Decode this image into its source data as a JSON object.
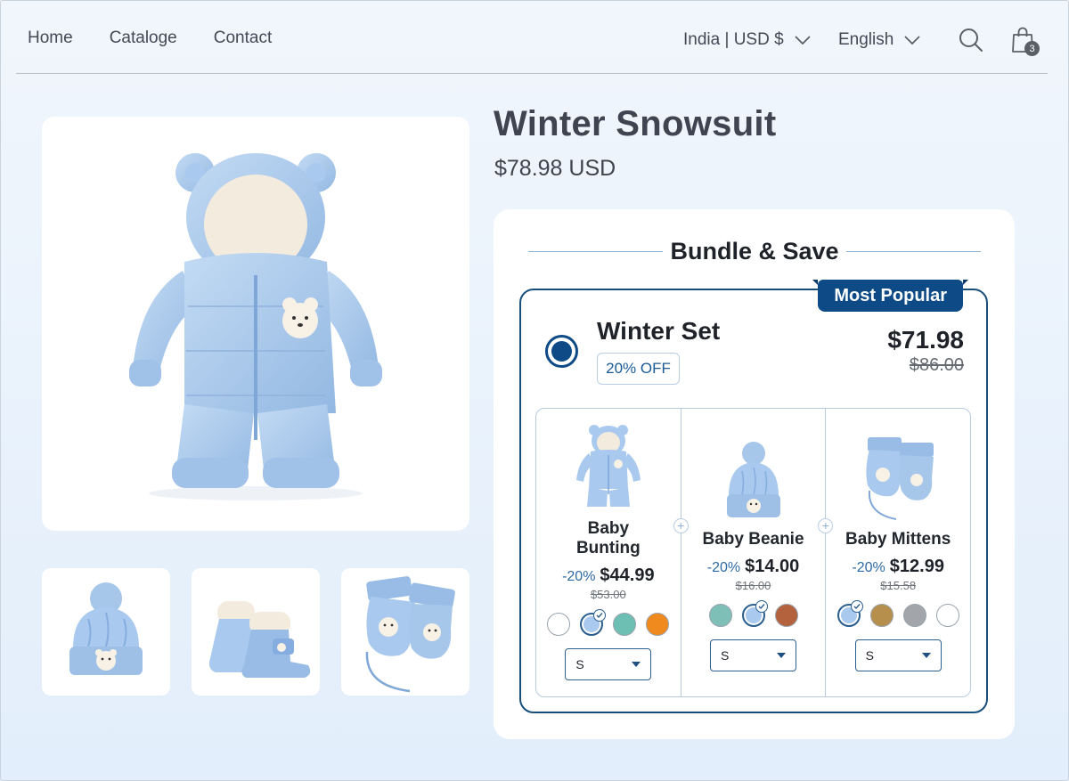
{
  "header": {
    "nav": [
      "Home",
      "Cataloge",
      "Contact"
    ],
    "country_currency": "India | USD $",
    "language": "English",
    "cart_count": "3"
  },
  "product": {
    "title": "Winter Snowsuit",
    "price": "$78.98 USD"
  },
  "bundle": {
    "heading": "Bundle & Save",
    "offer": {
      "tag": "Most Popular",
      "name": "Winter Set",
      "discount_badge": "20% OFF",
      "price": "$71.98",
      "compare_price": "$86.00",
      "selected": true
    },
    "items": [
      {
        "name": "Baby Bunting",
        "discount": "-20%",
        "price": "$44.99",
        "compare_price": "$53.00",
        "swatches": [
          "#ffffff",
          "#a9c9ee",
          "#6dbfb4",
          "#f08a1e"
        ],
        "selected_swatch": 1,
        "size": "S"
      },
      {
        "name": "Baby Beanie",
        "discount": "-20%",
        "price": "$14.00",
        "compare_price": "$16.00",
        "swatches": [
          "#7ebfb8",
          "#a9c9ee",
          "#b3623d"
        ],
        "selected_swatch": 1,
        "size": "S"
      },
      {
        "name": "Baby Mittens",
        "discount": "-20%",
        "price": "$12.99",
        "compare_price": "$15.58",
        "swatches": [
          "#a9c9ee",
          "#b58f4b",
          "#a2a6aa",
          "#ffffff"
        ],
        "selected_swatch": 0,
        "size": "S"
      }
    ]
  },
  "colors": {
    "accent": "#0d4a86",
    "product_blue": "#a9c9ee"
  }
}
